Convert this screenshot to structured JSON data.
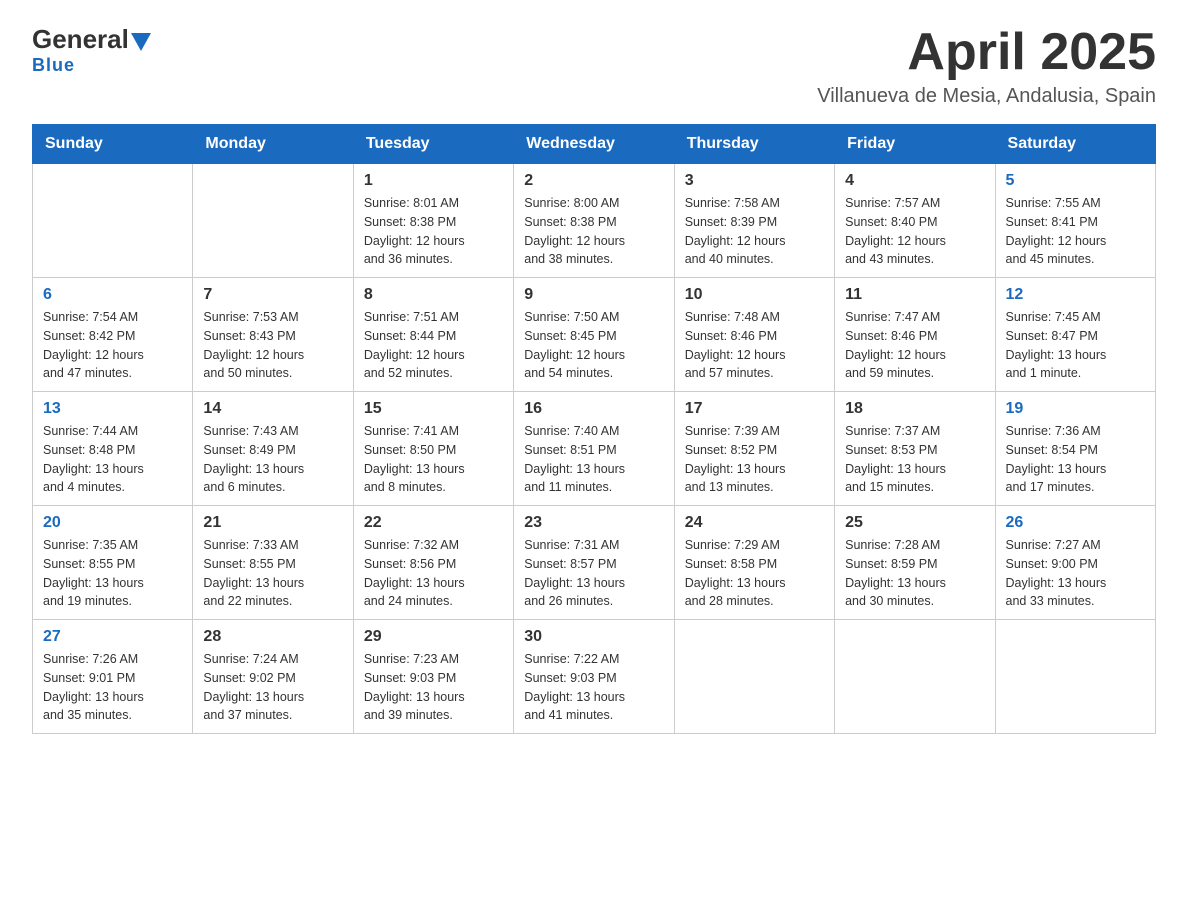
{
  "header": {
    "logo_general": "General",
    "logo_blue": "Blue",
    "title": "April 2025",
    "location": "Villanueva de Mesia, Andalusia, Spain"
  },
  "weekdays": [
    "Sunday",
    "Monday",
    "Tuesday",
    "Wednesday",
    "Thursday",
    "Friday",
    "Saturday"
  ],
  "weeks": [
    [
      {
        "day": "",
        "info": ""
      },
      {
        "day": "",
        "info": ""
      },
      {
        "day": "1",
        "info": "Sunrise: 8:01 AM\nSunset: 8:38 PM\nDaylight: 12 hours\nand 36 minutes."
      },
      {
        "day": "2",
        "info": "Sunrise: 8:00 AM\nSunset: 8:38 PM\nDaylight: 12 hours\nand 38 minutes."
      },
      {
        "day": "3",
        "info": "Sunrise: 7:58 AM\nSunset: 8:39 PM\nDaylight: 12 hours\nand 40 minutes."
      },
      {
        "day": "4",
        "info": "Sunrise: 7:57 AM\nSunset: 8:40 PM\nDaylight: 12 hours\nand 43 minutes."
      },
      {
        "day": "5",
        "info": "Sunrise: 7:55 AM\nSunset: 8:41 PM\nDaylight: 12 hours\nand 45 minutes."
      }
    ],
    [
      {
        "day": "6",
        "info": "Sunrise: 7:54 AM\nSunset: 8:42 PM\nDaylight: 12 hours\nand 47 minutes."
      },
      {
        "day": "7",
        "info": "Sunrise: 7:53 AM\nSunset: 8:43 PM\nDaylight: 12 hours\nand 50 minutes."
      },
      {
        "day": "8",
        "info": "Sunrise: 7:51 AM\nSunset: 8:44 PM\nDaylight: 12 hours\nand 52 minutes."
      },
      {
        "day": "9",
        "info": "Sunrise: 7:50 AM\nSunset: 8:45 PM\nDaylight: 12 hours\nand 54 minutes."
      },
      {
        "day": "10",
        "info": "Sunrise: 7:48 AM\nSunset: 8:46 PM\nDaylight: 12 hours\nand 57 minutes."
      },
      {
        "day": "11",
        "info": "Sunrise: 7:47 AM\nSunset: 8:46 PM\nDaylight: 12 hours\nand 59 minutes."
      },
      {
        "day": "12",
        "info": "Sunrise: 7:45 AM\nSunset: 8:47 PM\nDaylight: 13 hours\nand 1 minute."
      }
    ],
    [
      {
        "day": "13",
        "info": "Sunrise: 7:44 AM\nSunset: 8:48 PM\nDaylight: 13 hours\nand 4 minutes."
      },
      {
        "day": "14",
        "info": "Sunrise: 7:43 AM\nSunset: 8:49 PM\nDaylight: 13 hours\nand 6 minutes."
      },
      {
        "day": "15",
        "info": "Sunrise: 7:41 AM\nSunset: 8:50 PM\nDaylight: 13 hours\nand 8 minutes."
      },
      {
        "day": "16",
        "info": "Sunrise: 7:40 AM\nSunset: 8:51 PM\nDaylight: 13 hours\nand 11 minutes."
      },
      {
        "day": "17",
        "info": "Sunrise: 7:39 AM\nSunset: 8:52 PM\nDaylight: 13 hours\nand 13 minutes."
      },
      {
        "day": "18",
        "info": "Sunrise: 7:37 AM\nSunset: 8:53 PM\nDaylight: 13 hours\nand 15 minutes."
      },
      {
        "day": "19",
        "info": "Sunrise: 7:36 AM\nSunset: 8:54 PM\nDaylight: 13 hours\nand 17 minutes."
      }
    ],
    [
      {
        "day": "20",
        "info": "Sunrise: 7:35 AM\nSunset: 8:55 PM\nDaylight: 13 hours\nand 19 minutes."
      },
      {
        "day": "21",
        "info": "Sunrise: 7:33 AM\nSunset: 8:55 PM\nDaylight: 13 hours\nand 22 minutes."
      },
      {
        "day": "22",
        "info": "Sunrise: 7:32 AM\nSunset: 8:56 PM\nDaylight: 13 hours\nand 24 minutes."
      },
      {
        "day": "23",
        "info": "Sunrise: 7:31 AM\nSunset: 8:57 PM\nDaylight: 13 hours\nand 26 minutes."
      },
      {
        "day": "24",
        "info": "Sunrise: 7:29 AM\nSunset: 8:58 PM\nDaylight: 13 hours\nand 28 minutes."
      },
      {
        "day": "25",
        "info": "Sunrise: 7:28 AM\nSunset: 8:59 PM\nDaylight: 13 hours\nand 30 minutes."
      },
      {
        "day": "26",
        "info": "Sunrise: 7:27 AM\nSunset: 9:00 PM\nDaylight: 13 hours\nand 33 minutes."
      }
    ],
    [
      {
        "day": "27",
        "info": "Sunrise: 7:26 AM\nSunset: 9:01 PM\nDaylight: 13 hours\nand 35 minutes."
      },
      {
        "day": "28",
        "info": "Sunrise: 7:24 AM\nSunset: 9:02 PM\nDaylight: 13 hours\nand 37 minutes."
      },
      {
        "day": "29",
        "info": "Sunrise: 7:23 AM\nSunset: 9:03 PM\nDaylight: 13 hours\nand 39 minutes."
      },
      {
        "day": "30",
        "info": "Sunrise: 7:22 AM\nSunset: 9:03 PM\nDaylight: 13 hours\nand 41 minutes."
      },
      {
        "day": "",
        "info": ""
      },
      {
        "day": "",
        "info": ""
      },
      {
        "day": "",
        "info": ""
      }
    ]
  ]
}
